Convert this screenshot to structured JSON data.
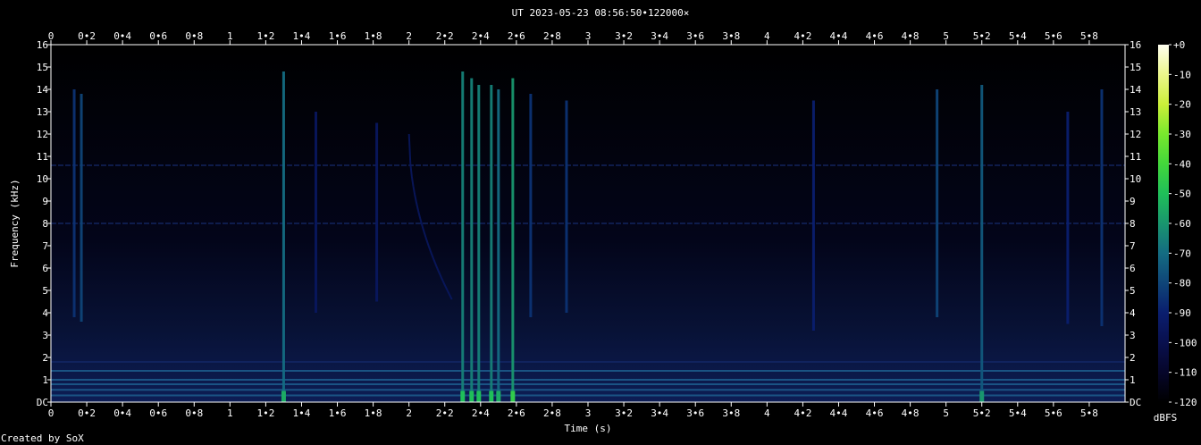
{
  "chart_data": {
    "type": "heatmap",
    "title": "UT 2023-05-23 08:56:50•122000×",
    "xlabel": "Time (s)",
    "ylabel": "Frequency (kHz)",
    "xlim": [
      0,
      6
    ],
    "ylim": [
      0,
      16
    ],
    "x_ticks": [
      "0",
      "0•2",
      "0•4",
      "0•6",
      "0•8",
      "1",
      "1•2",
      "1•4",
      "1•6",
      "1•8",
      "2",
      "2•2",
      "2•4",
      "2•6",
      "2•8",
      "3",
      "3•2",
      "3•4",
      "3•6",
      "3•8",
      "4",
      "4•2",
      "4•4",
      "4•6",
      "4•8",
      "5",
      "5•2",
      "5•4",
      "5•6",
      "5•8"
    ],
    "y_ticks": [
      "DC",
      "1",
      "2",
      "3",
      "4",
      "5",
      "6",
      "7",
      "8",
      "9",
      "10",
      "11",
      "12",
      "13",
      "14",
      "15",
      "16"
    ],
    "colorbar": {
      "label": "dBFS",
      "ticks": [
        "+0",
        "-10",
        "-20",
        "-30",
        "-40",
        "-50",
        "-60",
        "-70",
        "-80",
        "-90",
        "-100",
        "-110",
        "-120"
      ],
      "range": [
        -120,
        0
      ]
    },
    "footer": "Created by SoX",
    "background_color": "#000000",
    "noise_color": "#0a1030",
    "signal_color": "#20a0a0",
    "strong_signal_color": "#30d070",
    "hum_lines_khz": [
      0.3,
      0.55,
      0.8,
      1.0,
      1.4,
      1.8,
      10.6,
      8.0
    ],
    "clicks": [
      {
        "t": 0.13,
        "f_low": 3.8,
        "f_high": 14.0,
        "level": -85
      },
      {
        "t": 0.17,
        "f_low": 3.6,
        "f_high": 13.8,
        "level": -80
      },
      {
        "t": 1.3,
        "f_low": 0.0,
        "f_high": 14.8,
        "level": -70
      },
      {
        "t": 1.48,
        "f_low": 4.0,
        "f_high": 13.0,
        "level": -95
      },
      {
        "t": 1.82,
        "f_low": 4.5,
        "f_high": 12.5,
        "level": -95
      },
      {
        "t": 2.3,
        "f_low": 0.0,
        "f_high": 14.8,
        "level": -65
      },
      {
        "t": 2.35,
        "f_low": 0.0,
        "f_high": 14.5,
        "level": -65
      },
      {
        "t": 2.39,
        "f_low": 0.0,
        "f_high": 14.2,
        "level": -65
      },
      {
        "t": 2.46,
        "f_low": 0.0,
        "f_high": 14.2,
        "level": -65
      },
      {
        "t": 2.5,
        "f_low": 0.0,
        "f_high": 14.0,
        "level": -70
      },
      {
        "t": 2.58,
        "f_low": 0.0,
        "f_high": 14.5,
        "level": -60
      },
      {
        "t": 2.68,
        "f_low": 3.8,
        "f_high": 13.8,
        "level": -85
      },
      {
        "t": 2.88,
        "f_low": 4.0,
        "f_high": 13.5,
        "level": -85
      },
      {
        "t": 4.26,
        "f_low": 3.2,
        "f_high": 13.5,
        "level": -90
      },
      {
        "t": 4.95,
        "f_low": 3.8,
        "f_high": 14.0,
        "level": -80
      },
      {
        "t": 5.2,
        "f_low": 0.0,
        "f_high": 14.2,
        "level": -75
      },
      {
        "t": 5.68,
        "f_low": 3.5,
        "f_high": 13.0,
        "level": -90
      },
      {
        "t": 5.87,
        "f_low": 3.4,
        "f_high": 14.0,
        "level": -85
      }
    ],
    "sweep": {
      "t_start": 2.0,
      "f_start": 12.0,
      "t_end": 2.24,
      "f_end": 4.6,
      "level": -95
    }
  }
}
